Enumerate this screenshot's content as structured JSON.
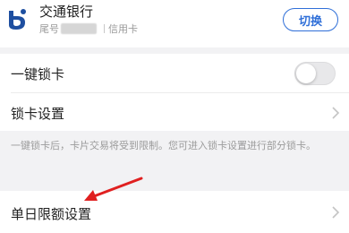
{
  "card": {
    "bank_name": "交通银行",
    "tail_label": "尾号",
    "card_type": "信用卡",
    "switch_label": "切换",
    "brand_color": "#2f6fd8"
  },
  "settings": {
    "one_key_lock": {
      "label": "一键锁卡",
      "enabled": false
    },
    "lock_settings": {
      "label": "锁卡设置"
    },
    "hint": "一键锁卡后，卡片交易将受到限制。您可进入锁卡设置进行部分锁卡。",
    "daily_limit": {
      "label": "单日限额设置"
    }
  },
  "annotation": {
    "arrow_color": "#e02020"
  }
}
